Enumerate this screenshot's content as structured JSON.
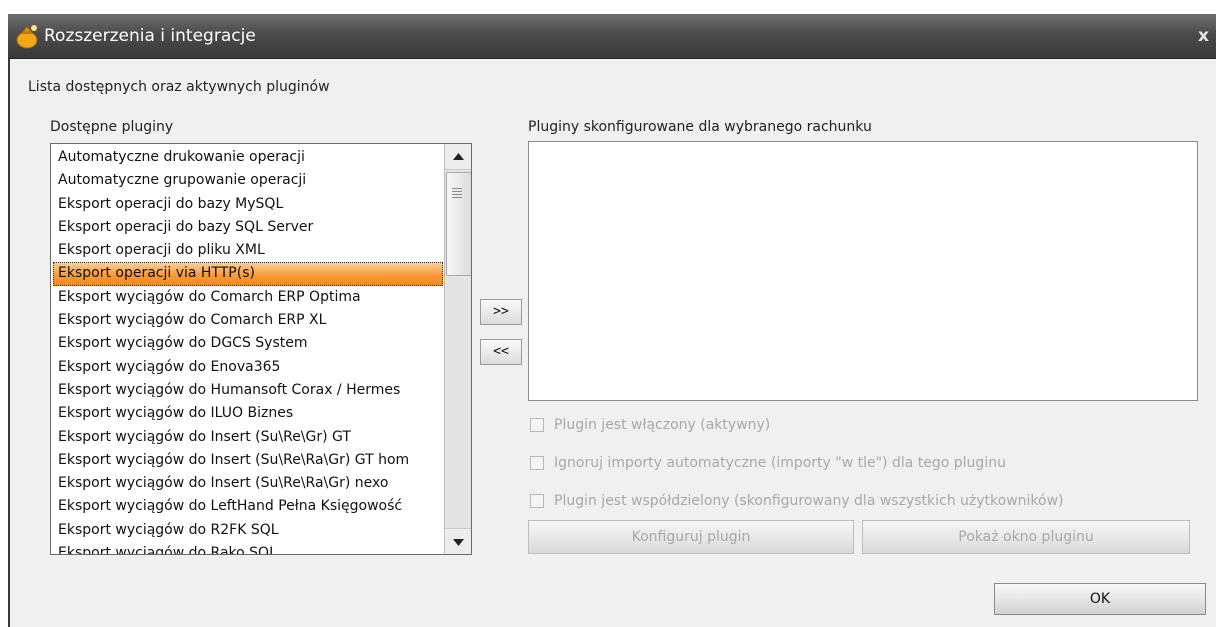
{
  "window": {
    "title": "Rozszerzenia i integracje",
    "close_glyph": "x",
    "app_icon": "money-bag-icon"
  },
  "header": {
    "description": "Lista dostępnych oraz aktywnych pluginów"
  },
  "available": {
    "label": "Dostępne pluginy",
    "selected_index": 5,
    "items": [
      "Automatyczne drukowanie operacji",
      "Automatyczne grupowanie operacji",
      "Eksport operacji do bazy MySQL",
      "Eksport operacji do bazy SQL Server",
      "Eksport operacji do pliku XML",
      "Eksport operacji via HTTP(s)",
      "Eksport wyciągów do Comarch ERP Optima",
      "Eksport wyciągów do Comarch ERP XL",
      "Eksport wyciągów do DGCS System",
      "Eksport wyciągów do Enova365",
      "Eksport wyciągów do Humansoft Corax / Hermes",
      "Eksport wyciągów do ILUO Biznes",
      "Eksport wyciągów do Insert (Su\\Re\\Gr) GT",
      "Eksport wyciągów do Insert (Su\\Re\\Ra\\Gr) GT hom",
      "Eksport wyciągów do Insert (Su\\Re\\Ra\\Gr) nexo",
      "Eksport wyciągów do LeftHand Pełna Księgowość",
      "Eksport wyciągów do R2FK SQL",
      "Eksport wyciągów do Rako SQL"
    ]
  },
  "configured": {
    "label": "Pluginy skonfigurowane dla wybranego rachunku",
    "items": []
  },
  "buttons": {
    "add": ">>",
    "remove": "<<",
    "configure": "Konfiguruj plugin",
    "show_window": "Pokaż okno pluginu",
    "ok": "OK"
  },
  "options": {
    "enabled": "Plugin jest włączony (aktywny)",
    "ignore_auto": "Ignoruj importy automatyczne (importy \"w tle\") dla tego pluginu",
    "shared": "Plugin jest współdzielony (skonfigurowany dla wszystkich użytkowników)"
  }
}
